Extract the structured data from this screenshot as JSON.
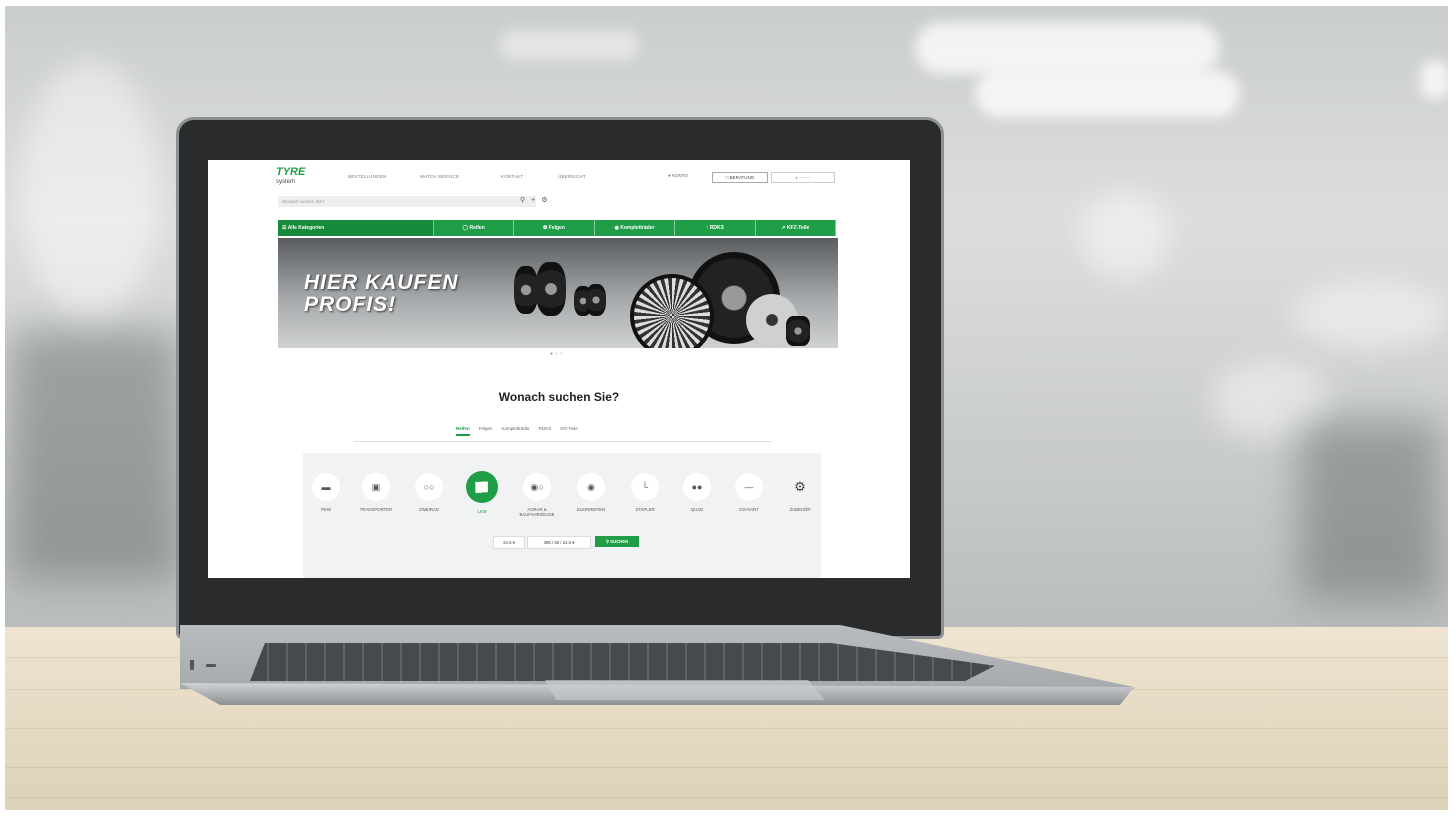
{
  "site": {
    "logo_main": "TYRE",
    "logo_sub": "system",
    "nav": [
      "BESTELLUNGEN",
      "MATCH SERVICE",
      "KONTAKT",
      "ÜBERSICHT"
    ],
    "account_label": "KONTO",
    "beratung_label": "BERATUNG",
    "search_placeholder": "Wonach suchen Sie?",
    "categories": [
      "Alle Kategorien",
      "Reifen",
      "Felgen",
      "Komplett­räder",
      "RDKS",
      "KFZ-Teile"
    ],
    "banner_text_line1": "HIER KAUFEN",
    "banner_text_line2": "PROFIS!",
    "section_title": "Wonach suchen Sie?",
    "tabs": [
      "Reifen",
      "Felgen",
      "Kompletträder",
      "RDKS",
      "Kfz-Teile"
    ],
    "vehicles": [
      {
        "label": "PKW",
        "icon": "car-icon"
      },
      {
        "label": "TRANSPORTER",
        "icon": "van-icon"
      },
      {
        "label": "ZWEIRAD",
        "icon": "motorcycle-icon"
      },
      {
        "label": "LKW",
        "icon": "truck-icon",
        "selected": true
      },
      {
        "label": "AGRAR & BAUFAHRZEUGE",
        "icon": "tractor-icon"
      },
      {
        "label": "KLEINREIFEN",
        "icon": "small-tire-icon"
      },
      {
        "label": "STAPLER",
        "icon": "forklift-icon"
      },
      {
        "label": "QUAD",
        "icon": "quad-icon"
      },
      {
        "label": "GO-KART",
        "icon": "gokart-icon"
      },
      {
        "label": "ZUBEHÖR",
        "icon": "gears-icon"
      }
    ],
    "rim_select": "22.5",
    "size_select": "385 / 65 / 22.5",
    "search_button": "SUCHEN"
  },
  "colors": {
    "brand_green": "#1f9e47"
  }
}
